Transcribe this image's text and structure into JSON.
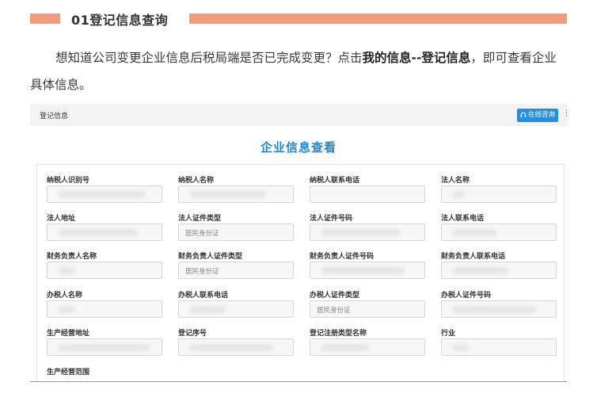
{
  "section": {
    "title": "01登记信息查询",
    "intro_prefix": "想知道公司变更企业信息后税局端是否已完成变更？点击",
    "intro_bold": "我的信息--登记信息",
    "intro_suffix": "，即可查看企业具体信息。"
  },
  "screenshot": {
    "breadcrumb": "登记信息",
    "online_button": "在线咨询",
    "page_title": "企业信息查看",
    "fields": [
      {
        "label": "纳税人识别号",
        "value": ""
      },
      {
        "label": "纳税人名称",
        "value": ""
      },
      {
        "label": "纳税人联系电话",
        "value": ""
      },
      {
        "label": "法人名称",
        "value": ""
      },
      {
        "label": "法人地址",
        "value": ""
      },
      {
        "label": "法人证件类型",
        "value": "居民身份证"
      },
      {
        "label": "法人证件号码",
        "value": ""
      },
      {
        "label": "法人联系电话",
        "value": ""
      },
      {
        "label": "财务负责人名称",
        "value": ""
      },
      {
        "label": "财务负责人证件类型",
        "value": "居民身份证"
      },
      {
        "label": "财务负责人证件号码",
        "value": ""
      },
      {
        "label": "财务负责人联系电话",
        "value": ""
      },
      {
        "label": "办税人名称",
        "value": ""
      },
      {
        "label": "办税人联系电话",
        "value": ""
      },
      {
        "label": "办税人证件类型",
        "value": "居民身份证"
      },
      {
        "label": "办税人证件号码",
        "value": ""
      },
      {
        "label": "生产经营地址",
        "value": ""
      },
      {
        "label": "登记序号",
        "value": ""
      },
      {
        "label": "登记注册类型名称",
        "value": ""
      },
      {
        "label": "行业",
        "value": ""
      },
      {
        "label": "生产经营范围",
        "value": ""
      }
    ],
    "colors": {
      "accent": "#1e90e8",
      "title": "#1e88d6",
      "section_bar": "#f49a7a"
    }
  }
}
